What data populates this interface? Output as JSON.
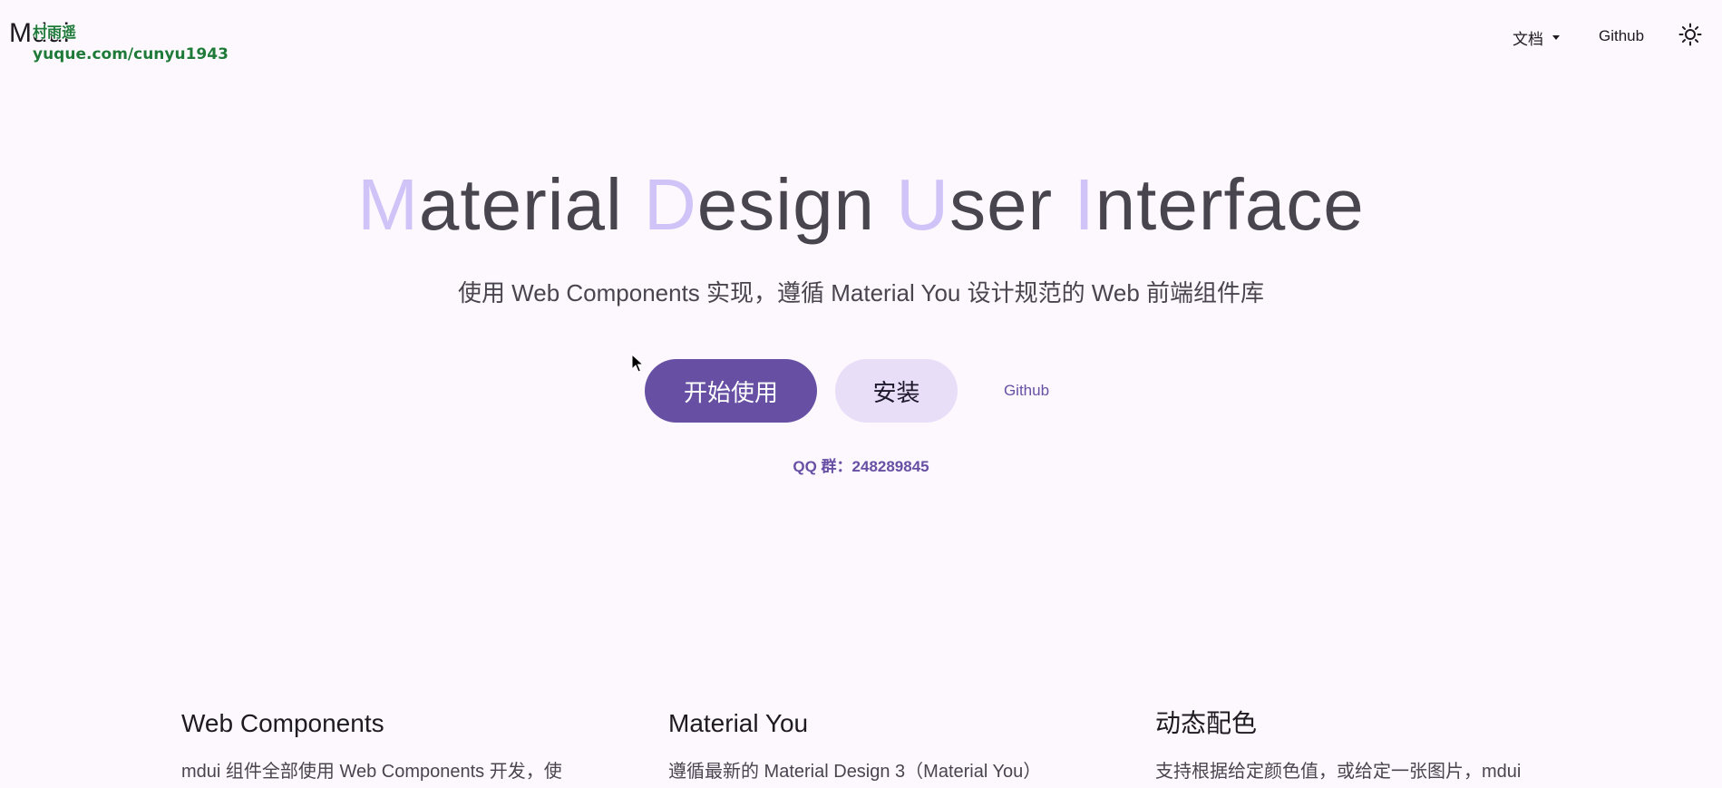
{
  "topbar": {
    "logo": "Mdui",
    "watermark_line1": "村雨遥",
    "watermark_line2": "yuque.com/cunyu1943",
    "nav_docs": "文档",
    "nav_github": "Github",
    "theme_icon": "sun-icon"
  },
  "hero": {
    "title_parts": [
      {
        "cap": "M",
        "rest": "aterial"
      },
      {
        "cap": "D",
        "rest": "esign"
      },
      {
        "cap": "U",
        "rest": "ser"
      },
      {
        "cap": "I",
        "rest": "nterface"
      }
    ],
    "subtitle": "使用 Web Components 实现，遵循 Material You 设计规范的 Web 前端组件库",
    "buttons": {
      "start": "开始使用",
      "install": "安装",
      "github": "Github"
    },
    "qq_group": "QQ 群：248289845"
  },
  "features": [
    {
      "title": "Web Components",
      "text": "mdui 组件全部使用 Web Components 开发，使"
    },
    {
      "title": "Material You",
      "text": "遵循最新的 Material Design 3（Material You）"
    },
    {
      "title": "动态配色",
      "text": "支持根据给定颜色值，或给定一张图片，mdui"
    }
  ],
  "colors": {
    "background": "#fdf7fe",
    "primary": "#6750a4",
    "secondary_container": "#e8def8",
    "title_accent": "#cfc3f8",
    "text": "#49454f"
  }
}
